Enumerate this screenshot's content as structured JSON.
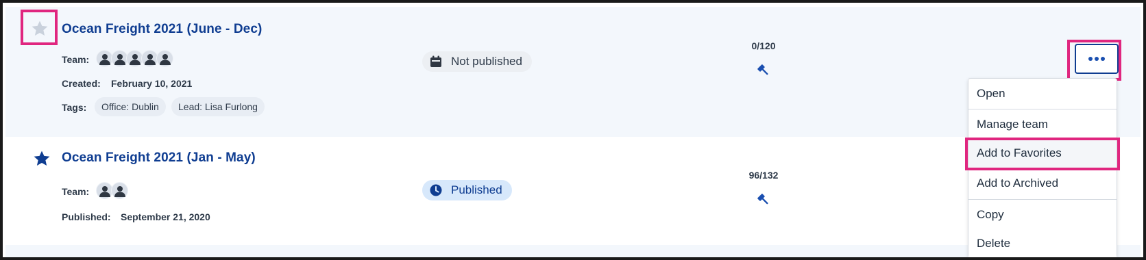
{
  "projects": [
    {
      "title": "Ocean Freight 2021 (June - Dec)",
      "favorite": false,
      "team_label": "Team:",
      "team_count": 5,
      "date_label": "Created:",
      "date_value": "February 10, 2021",
      "tags_label": "Tags:",
      "tags": [
        "Office: Dublin",
        "Lead: Lisa Furlong"
      ],
      "status": "Not published",
      "status_icon": "calendar-icon",
      "count": "0/120",
      "count_icon": "gavel-icon"
    },
    {
      "title": "Ocean Freight 2021 (Jan - May)",
      "favorite": true,
      "team_label": "Team:",
      "team_count": 2,
      "date_label": "Published:",
      "date_value": "September 21, 2020",
      "status": "Published",
      "status_icon": "clock-icon",
      "count": "96/132",
      "count_icon": "gavel-icon"
    }
  ],
  "more_button_icon": "more-horizontal-icon",
  "context_menu": {
    "items": [
      "Open",
      "Manage team",
      "Add to Favorites",
      "Add to Archived",
      "Copy",
      "Delete"
    ]
  },
  "colors": {
    "brand_blue": "#0f3d91",
    "highlight_pink": "#e0267f",
    "row_tint": "#f3f7fc",
    "published_bg": "#d7e8fb"
  }
}
